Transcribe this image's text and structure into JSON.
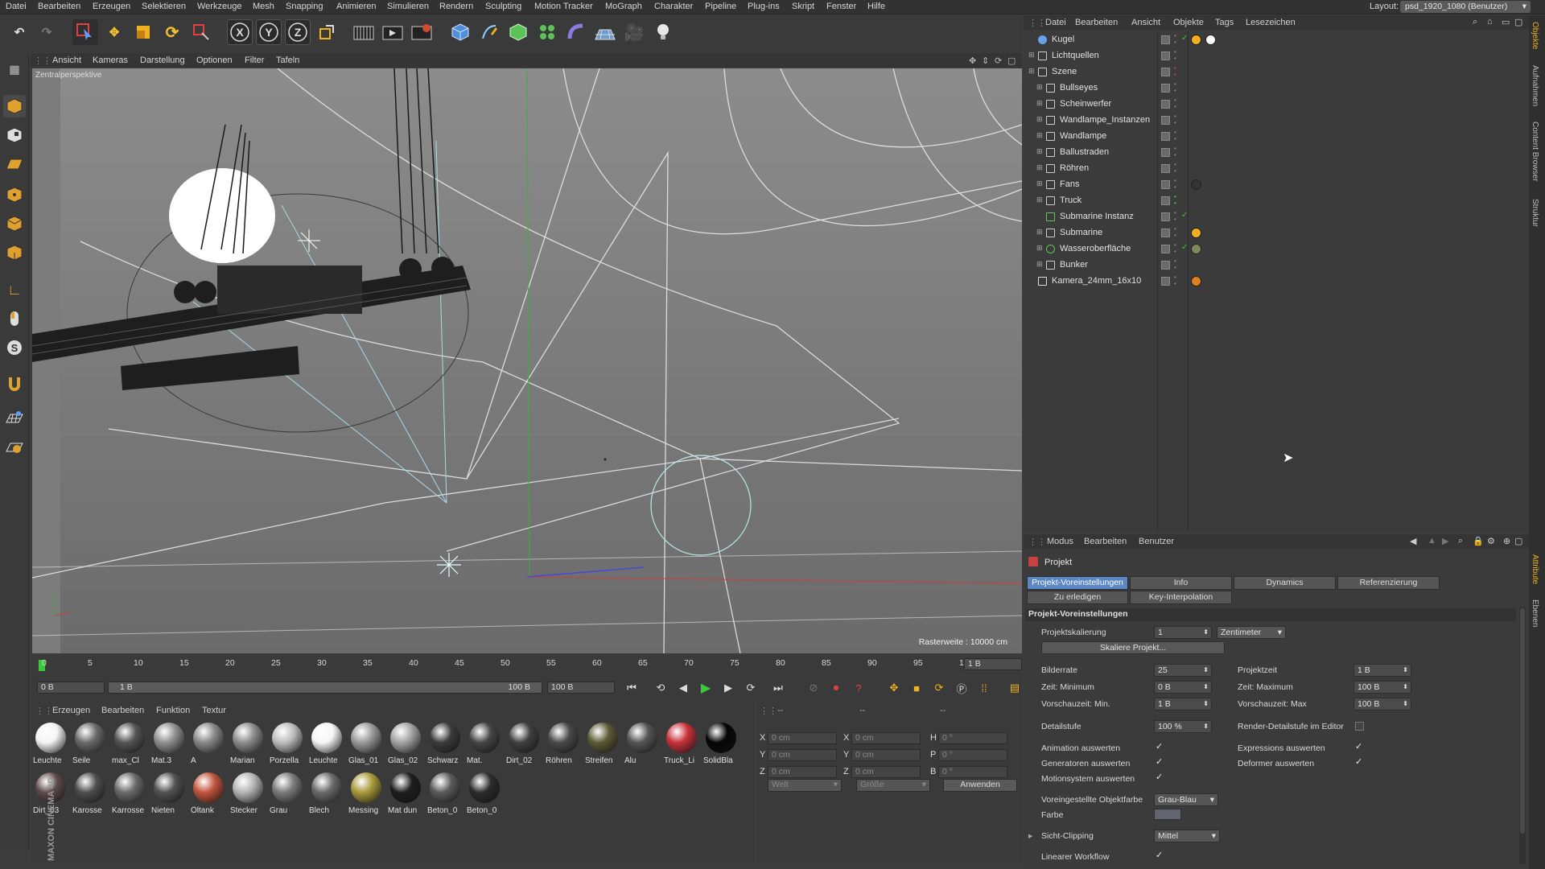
{
  "menu": {
    "items": [
      "Datei",
      "Bearbeiten",
      "Erzeugen",
      "Selektieren",
      "Werkzeuge",
      "Mesh",
      "Snapping",
      "Animieren",
      "Simulieren",
      "Rendern",
      "Sculpting",
      "Motion Tracker",
      "MoGraph",
      "Charakter",
      "Pipeline",
      "Plug-ins",
      "Skript",
      "Fenster",
      "Hilfe"
    ],
    "layout_label": "Layout:",
    "layout_value": "psd_1920_1080 (Benutzer)"
  },
  "viewport": {
    "menu": [
      "Ansicht",
      "Kameras",
      "Darstellung",
      "Optionen",
      "Filter",
      "Tafeln"
    ],
    "label": "Zentralperspektive",
    "raster": "Rasterweite : 10000 cm"
  },
  "timeline": {
    "ticks": [
      "0",
      "5",
      "10",
      "15",
      "20",
      "25",
      "30",
      "35",
      "40",
      "45",
      "50",
      "55",
      "60",
      "65",
      "70",
      "75",
      "80",
      "85",
      "90",
      "95",
      "100"
    ],
    "current": "1 B"
  },
  "transport": {
    "start": "0 B",
    "range_left": "1 B",
    "range_right": "100 B",
    "end": "100 B"
  },
  "materials": {
    "menu": [
      "Erzeugen",
      "Bearbeiten",
      "Funktion",
      "Textur"
    ],
    "row1": [
      {
        "name": "Leuchte",
        "color": "#f4f4f4"
      },
      {
        "name": "Seile",
        "color": "#6a6a6a"
      },
      {
        "name": "max_Cl",
        "color": "#555555"
      },
      {
        "name": "Mat.3",
        "color": "#909090"
      },
      {
        "name": "A",
        "color": "#888888"
      },
      {
        "name": "Marian",
        "color": "#8c8c8c"
      },
      {
        "name": "Porzella",
        "color": "#bdbdbd"
      },
      {
        "name": "Leuchte",
        "color": "#f6f6f6"
      },
      {
        "name": "Glas_01",
        "color": "#9a9a9a"
      },
      {
        "name": "Glas_02",
        "color": "#a3a3a3"
      },
      {
        "name": "Schwarz",
        "color": "#3b3b3b"
      },
      {
        "name": "Mat.",
        "color": "#454545"
      },
      {
        "name": "Dirt_02",
        "color": "#3f3f3f"
      },
      {
        "name": "Röhren",
        "color": "#4a4a4a"
      },
      {
        "name": "Streifen",
        "color": "#5c5a35"
      },
      {
        "name": "Alu",
        "color": "#555555"
      },
      {
        "name": "Truck_Li",
        "color": "#c8323a"
      },
      {
        "name": "SolidBla",
        "color": "#050505"
      }
    ],
    "row2": [
      {
        "name": "Dirt_03",
        "color": "#5e4a4a"
      },
      {
        "name": "Karosse",
        "color": "#4e4e4e"
      },
      {
        "name": "Karrosse",
        "color": "#6a6a6a"
      },
      {
        "name": "Nieten",
        "color": "#525252"
      },
      {
        "name": "Öltank",
        "color": "#c2543c"
      },
      {
        "name": "Stecker",
        "color": "#b4b4b4"
      },
      {
        "name": "Grau",
        "color": "#7a7a7a"
      },
      {
        "name": "Blech",
        "color": "#6a6a6a"
      },
      {
        "name": "Messing",
        "color": "#a89a3a"
      },
      {
        "name": "Mat dun",
        "color": "#1e1e1e"
      },
      {
        "name": "Beton_0",
        "color": "#5a5a5a"
      },
      {
        "name": "Beton_0",
        "color": "#2c2c2c"
      }
    ]
  },
  "coords": {
    "headers": [
      "--",
      "--",
      "--"
    ],
    "rows": [
      {
        "a": "X",
        "av": "0 cm",
        "b": "X",
        "bv": "0 cm",
        "c": "H",
        "cv": "0 °"
      },
      {
        "a": "Y",
        "av": "0 cm",
        "b": "Y",
        "bv": "0 cm",
        "c": "P",
        "cv": "0 °"
      },
      {
        "a": "Z",
        "av": "0 cm",
        "b": "Z",
        "bv": "0 cm",
        "c": "B",
        "cv": "0 °"
      }
    ],
    "world": "Welt",
    "size": "Größe",
    "apply": "Anwenden"
  },
  "objects": {
    "menu": [
      "Datei",
      "Bearbeiten",
      "Ansicht",
      "Objekte",
      "Tags",
      "Lesezeichen"
    ],
    "items": [
      "Kugel",
      "Lichtquellen",
      "Szene",
      "Bullseyes",
      "Scheinwerfer",
      "Wandlampe_Instanzen",
      "Wandlampe",
      "Ballustraden",
      "Röhren",
      "Fans",
      "Truck",
      "Submarine Instanz",
      "Submarine",
      "Wasseroberfläche",
      "Bunker",
      "Kamera_24mm_16x10"
    ]
  },
  "attributes": {
    "menu": [
      "Modus",
      "Bearbeiten",
      "Benutzer"
    ],
    "title": "Projekt",
    "tabs": [
      "Projekt-Voreinstellungen",
      "Info",
      "Dynamics",
      "Referenzierung"
    ],
    "tabs2": [
      "Zu erledigen",
      "Key-Interpolation"
    ],
    "section": "Projekt-Voreinstellungen",
    "scale_label": "Projektskalierung",
    "scale_value": "1",
    "scale_unit": "Zentimeter",
    "scale_button": "Skaliere Projekt...",
    "fps_label": "Bilderrate",
    "fps_value": "25",
    "projtime_label": "Projektzeit",
    "projtime_value": "1 B",
    "tmin_label": "Zeit: Minimum",
    "tmin_value": "0 B",
    "tmax_label": "Zeit: Maximum",
    "tmax_value": "100 B",
    "pmin_label": "Vorschauzeit: Min.",
    "pmin_value": "1 B",
    "pmax_label": "Vorschauzeit: Max",
    "pmax_value": "100 B",
    "detail_label": "Detailstufe",
    "detail_value": "100 %",
    "render_detail_label": "Render-Detailstufe im Editor",
    "anim_label": "Animation auswerten",
    "expr_label": "Expressions auswerten",
    "gen_label": "Generatoren auswerten",
    "def_label": "Deformer auswerten",
    "motion_label": "Motionsystem auswerten",
    "objcolor_label": "Voreingestellte Objektfarbe",
    "objcolor_value": "Grau-Blau",
    "color_label": "Farbe",
    "clip_label": "Sicht-Clipping",
    "clip_value": "Mittel",
    "linear_label": "Linearer Workflow"
  },
  "side_tabs": [
    "Objekte",
    "Aufnahmen",
    "Content Browser",
    "Struktur",
    "Attribute",
    "Ebenen"
  ],
  "brand": "MAXON CINEMA 4D"
}
